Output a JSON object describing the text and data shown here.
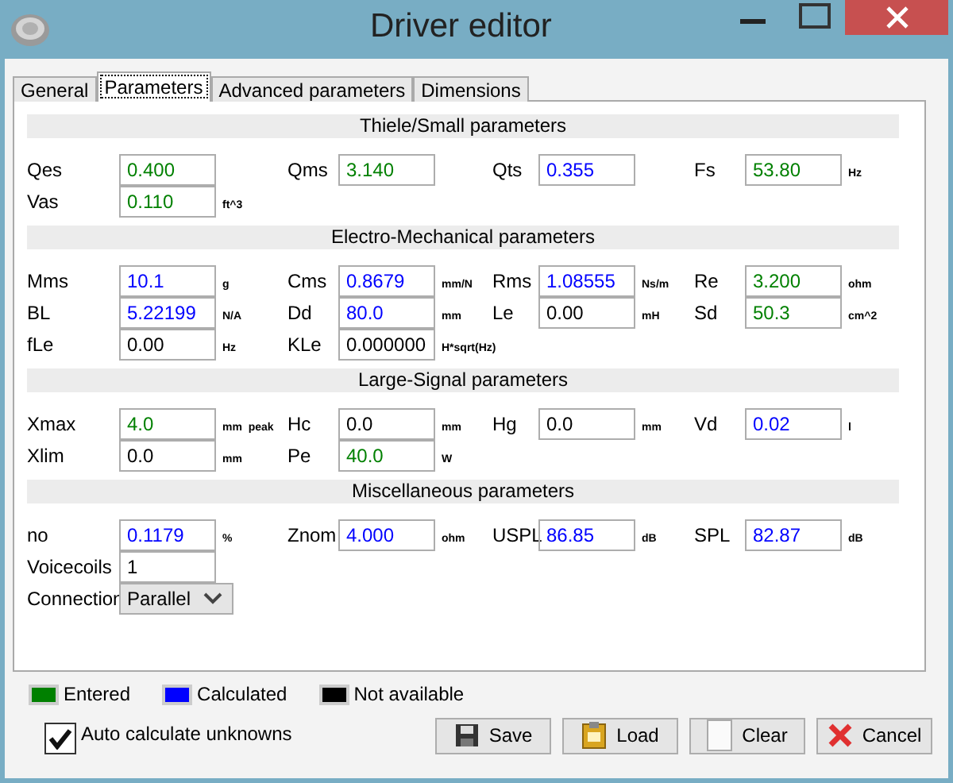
{
  "window": {
    "title": "Driver editor"
  },
  "tabs": [
    {
      "label": "General",
      "selected": false
    },
    {
      "label": "Parameters",
      "selected": true
    },
    {
      "label": "Advanced parameters",
      "selected": false
    },
    {
      "label": "Dimensions",
      "selected": false
    }
  ],
  "sections": [
    {
      "title": "Thiele/Small parameters",
      "rows": [
        [
          {
            "label": "Qes",
            "value": "0.400",
            "color": "#008000"
          },
          {
            "label": "Qms",
            "value": "3.140",
            "color": "#008000"
          },
          {
            "label": "Qts",
            "value": "0.355",
            "color": "#0000ff"
          },
          {
            "label": "Fs",
            "value": "53.80",
            "unit": "Hz",
            "color": "#008000"
          }
        ],
        [
          {
            "label": "Vas",
            "value": "0.110",
            "unit": "ft^3",
            "color": "#008000"
          }
        ]
      ]
    },
    {
      "title": "Electro-Mechanical parameters",
      "rows": [
        [
          {
            "label": "Mms",
            "value": "10.1",
            "unit": "g",
            "color": "#0000ff"
          },
          {
            "label": "Cms",
            "value": "0.8679",
            "unit": "mm/N",
            "color": "#0000ff"
          },
          {
            "label": "Rms",
            "value": "1.08555",
            "unit": "Ns/m",
            "color": "#0000ff"
          },
          {
            "label": "Re",
            "value": "3.200",
            "unit": "ohm",
            "color": "#008000"
          }
        ],
        [
          {
            "label": "BL",
            "value": "5.22199",
            "unit": "N/A",
            "color": "#0000ff"
          },
          {
            "label": "Dd",
            "value": "80.0",
            "unit": "mm",
            "color": "#0000ff"
          },
          {
            "label": "Le",
            "value": "0.00",
            "unit": "mH",
            "color": "#000000"
          },
          {
            "label": "Sd",
            "value": "50.3",
            "unit": "cm^2",
            "color": "#008000"
          }
        ],
        [
          {
            "label": "fLe",
            "value": "0.00",
            "unit": "Hz",
            "color": "#000000"
          },
          {
            "label": "KLe",
            "value": "0.000000",
            "unit": "H*sqrt(Hz)",
            "color": "#000000"
          }
        ]
      ]
    },
    {
      "title": "Large-Signal parameters",
      "rows": [
        [
          {
            "label": "Xmax",
            "value": "4.0",
            "unit": "mm  peak",
            "color": "#008000"
          },
          {
            "label": "Hc",
            "value": "0.0",
            "unit": "mm",
            "color": "#000000"
          },
          {
            "label": "Hg",
            "value": "0.0",
            "unit": "mm",
            "color": "#000000"
          },
          {
            "label": "Vd",
            "value": "0.02",
            "unit": "l",
            "color": "#0000ff"
          }
        ],
        [
          {
            "label": "Xlim",
            "value": "0.0",
            "unit": "mm",
            "color": "#000000"
          },
          {
            "label": "Pe",
            "value": "40.0",
            "unit": "W",
            "color": "#008000"
          }
        ]
      ]
    },
    {
      "title": "Miscellaneous parameters",
      "rows": [
        [
          {
            "label": "no",
            "value": "0.1179",
            "unit": "%",
            "color": "#0000ff"
          },
          {
            "label": "Znom",
            "value": "4.000",
            "unit": "ohm",
            "color": "#0000ff"
          },
          {
            "label": "USPL",
            "value": "86.85",
            "unit": "dB",
            "color": "#0000ff"
          },
          {
            "label": "SPL",
            "value": "82.87",
            "unit": "dB",
            "color": "#0000ff"
          }
        ],
        [
          {
            "label": "Voicecoils",
            "value": "1",
            "color": "#000000"
          }
        ],
        [
          {
            "label": "Connection",
            "value": "Parallel",
            "kind": "select"
          }
        ]
      ]
    }
  ],
  "legend": [
    {
      "label": "Entered",
      "color": "#008000"
    },
    {
      "label": "Calculated",
      "color": "#0000ff"
    },
    {
      "label": "Not available",
      "color": "#000000"
    }
  ],
  "auto_calculate": {
    "label": "Auto calculate unknowns",
    "checked": true
  },
  "buttons": [
    {
      "label": "Save",
      "kind": "save"
    },
    {
      "label": "Load",
      "kind": "load"
    },
    {
      "label": "Clear",
      "kind": "clear"
    },
    {
      "label": "Cancel",
      "kind": "cancel"
    }
  ]
}
